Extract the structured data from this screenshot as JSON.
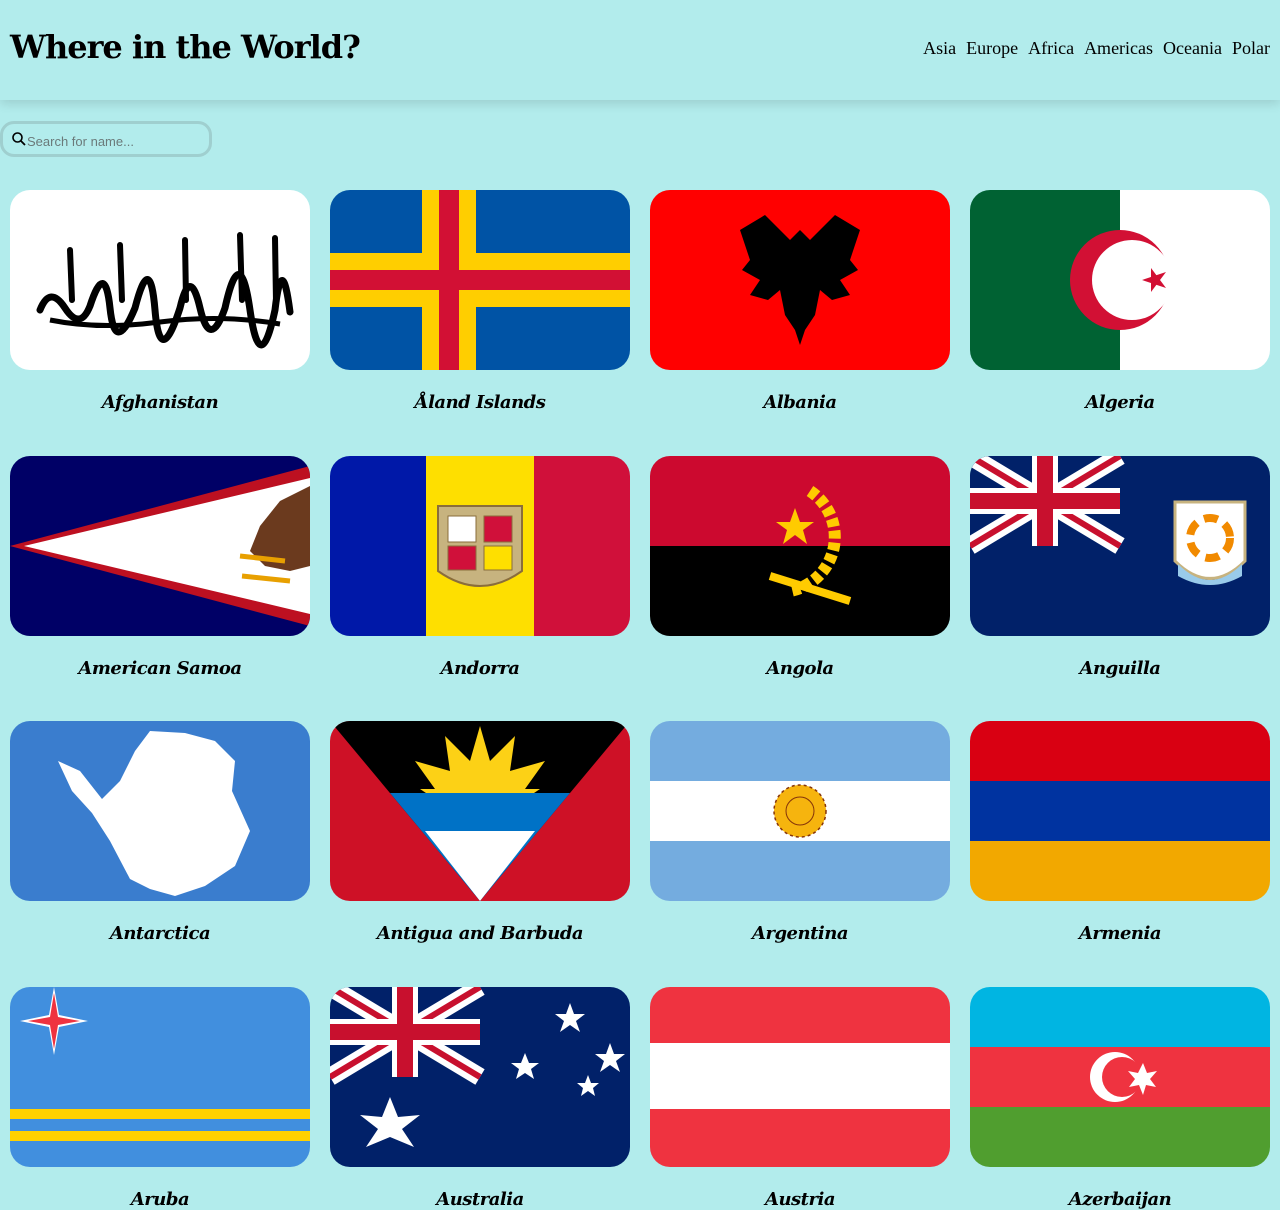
{
  "site": {
    "title": "Where in the World?"
  },
  "nav": [
    "Asia",
    "Europe",
    "Africa",
    "Americas",
    "Oceania",
    "Polar"
  ],
  "search": {
    "placeholder": "Search for name...",
    "value": ""
  },
  "countries": [
    {
      "name": "Afghanistan"
    },
    {
      "name": "Åland Islands"
    },
    {
      "name": "Albania"
    },
    {
      "name": "Algeria"
    },
    {
      "name": "American Samoa"
    },
    {
      "name": "Andorra"
    },
    {
      "name": "Angola"
    },
    {
      "name": "Anguilla"
    },
    {
      "name": "Antarctica"
    },
    {
      "name": "Antigua and Barbuda"
    },
    {
      "name": "Argentina"
    },
    {
      "name": "Armenia"
    },
    {
      "name": "Aruba"
    },
    {
      "name": "Australia"
    },
    {
      "name": "Austria"
    },
    {
      "name": "Azerbaijan"
    }
  ],
  "colors": {
    "background": "#b2ecec"
  }
}
